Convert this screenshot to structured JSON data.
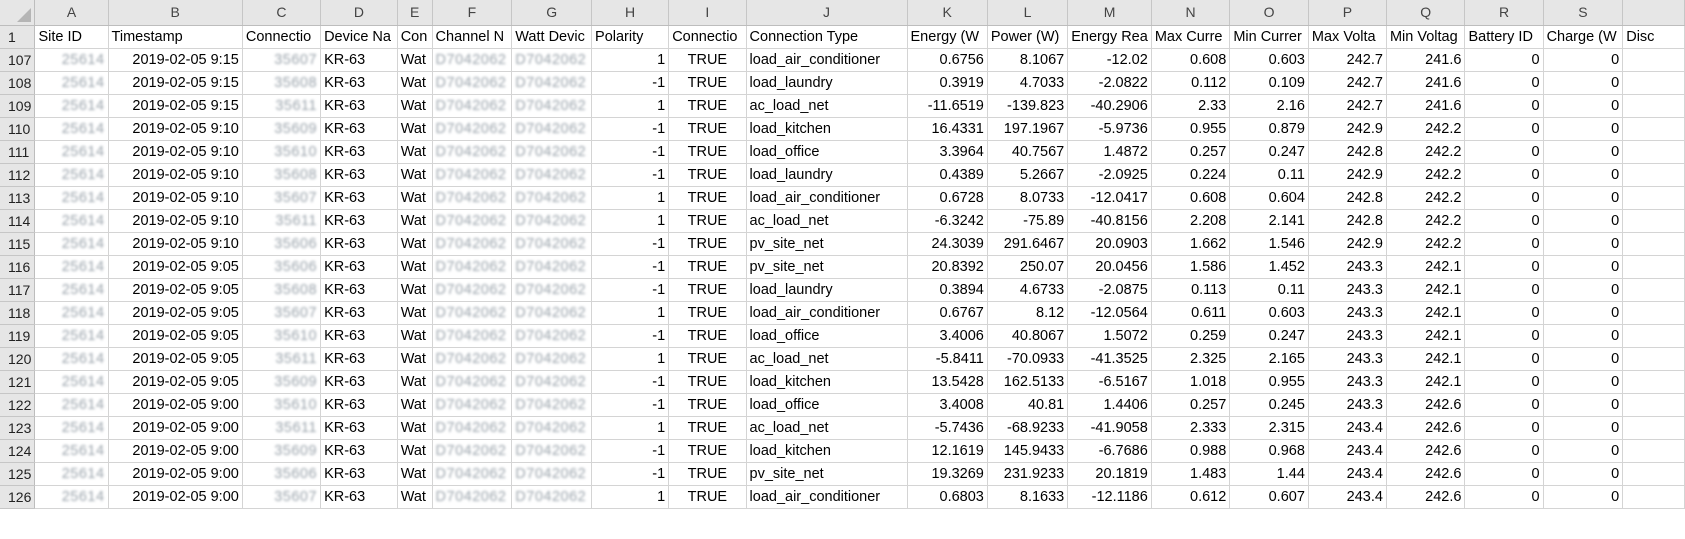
{
  "columns": [
    "A",
    "B",
    "C",
    "D",
    "E",
    "F",
    "G",
    "H",
    "I",
    "J",
    "K",
    "L",
    "M",
    "N",
    "O",
    "P",
    "Q",
    "R",
    "S",
    ""
  ],
  "header_row": {
    "row": "1",
    "cells": [
      "Site ID",
      "Timestamp",
      "Connectio",
      "Device Na",
      "Con",
      "Channel N",
      "Watt Devic",
      "Polarity",
      "Connectio",
      "Connection Type",
      "Energy (W",
      "Power (W)",
      "Energy Rea",
      "Max Curre",
      "Min Currer",
      "Max Volta",
      "Min Voltag",
      "Battery ID",
      "Charge (W",
      "Disc"
    ]
  },
  "rows": [
    {
      "row": "107",
      "site_id": "25614",
      "timestamp": "2019-02-05 9:15",
      "connection": "35607",
      "device": "KR-63",
      "con": "Wat",
      "channel": "D7042062",
      "watt_device": "D7042062",
      "polarity": "1",
      "connected": "TRUE",
      "type": "load_air_conditioner",
      "energy": "0.6756",
      "power": "8.1067",
      "energy_reactive": "-12.02",
      "max_current": "0.608",
      "min_current": "0.603",
      "max_voltage": "242.7",
      "min_voltage": "241.6",
      "battery": "0",
      "charge": "0"
    },
    {
      "row": "108",
      "site_id": "25614",
      "timestamp": "2019-02-05 9:15",
      "connection": "35608",
      "device": "KR-63",
      "con": "Wat",
      "channel": "D7042062",
      "watt_device": "D7042062",
      "polarity": "-1",
      "connected": "TRUE",
      "type": "load_laundry",
      "energy": "0.3919",
      "power": "4.7033",
      "energy_reactive": "-2.0822",
      "max_current": "0.112",
      "min_current": "0.109",
      "max_voltage": "242.7",
      "min_voltage": "241.6",
      "battery": "0",
      "charge": "0"
    },
    {
      "row": "109",
      "site_id": "25614",
      "timestamp": "2019-02-05 9:15",
      "connection": "35611",
      "device": "KR-63",
      "con": "Wat",
      "channel": "D7042062",
      "watt_device": "D7042062",
      "polarity": "1",
      "connected": "TRUE",
      "type": "ac_load_net",
      "energy": "-11.6519",
      "power": "-139.823",
      "energy_reactive": "-40.2906",
      "max_current": "2.33",
      "min_current": "2.16",
      "max_voltage": "242.7",
      "min_voltage": "241.6",
      "battery": "0",
      "charge": "0"
    },
    {
      "row": "110",
      "site_id": "25614",
      "timestamp": "2019-02-05 9:10",
      "connection": "35609",
      "device": "KR-63",
      "con": "Wat",
      "channel": "D7042062",
      "watt_device": "D7042062",
      "polarity": "-1",
      "connected": "TRUE",
      "type": "load_kitchen",
      "energy": "16.4331",
      "power": "197.1967",
      "energy_reactive": "-5.9736",
      "max_current": "0.955",
      "min_current": "0.879",
      "max_voltage": "242.9",
      "min_voltage": "242.2",
      "battery": "0",
      "charge": "0"
    },
    {
      "row": "111",
      "site_id": "25614",
      "timestamp": "2019-02-05 9:10",
      "connection": "35610",
      "device": "KR-63",
      "con": "Wat",
      "channel": "D7042062",
      "watt_device": "D7042062",
      "polarity": "-1",
      "connected": "TRUE",
      "type": "load_office",
      "energy": "3.3964",
      "power": "40.7567",
      "energy_reactive": "1.4872",
      "max_current": "0.257",
      "min_current": "0.247",
      "max_voltage": "242.8",
      "min_voltage": "242.2",
      "battery": "0",
      "charge": "0"
    },
    {
      "row": "112",
      "site_id": "25614",
      "timestamp": "2019-02-05 9:10",
      "connection": "35608",
      "device": "KR-63",
      "con": "Wat",
      "channel": "D7042062",
      "watt_device": "D7042062",
      "polarity": "-1",
      "connected": "TRUE",
      "type": "load_laundry",
      "energy": "0.4389",
      "power": "5.2667",
      "energy_reactive": "-2.0925",
      "max_current": "0.224",
      "min_current": "0.11",
      "max_voltage": "242.9",
      "min_voltage": "242.2",
      "battery": "0",
      "charge": "0"
    },
    {
      "row": "113",
      "site_id": "25614",
      "timestamp": "2019-02-05 9:10",
      "connection": "35607",
      "device": "KR-63",
      "con": "Wat",
      "channel": "D7042062",
      "watt_device": "D7042062",
      "polarity": "1",
      "connected": "TRUE",
      "type": "load_air_conditioner",
      "energy": "0.6728",
      "power": "8.0733",
      "energy_reactive": "-12.0417",
      "max_current": "0.608",
      "min_current": "0.604",
      "max_voltage": "242.8",
      "min_voltage": "242.2",
      "battery": "0",
      "charge": "0"
    },
    {
      "row": "114",
      "site_id": "25614",
      "timestamp": "2019-02-05 9:10",
      "connection": "35611",
      "device": "KR-63",
      "con": "Wat",
      "channel": "D7042062",
      "watt_device": "D7042062",
      "polarity": "1",
      "connected": "TRUE",
      "type": "ac_load_net",
      "energy": "-6.3242",
      "power": "-75.89",
      "energy_reactive": "-40.8156",
      "max_current": "2.208",
      "min_current": "2.141",
      "max_voltage": "242.8",
      "min_voltage": "242.2",
      "battery": "0",
      "charge": "0"
    },
    {
      "row": "115",
      "site_id": "25614",
      "timestamp": "2019-02-05 9:10",
      "connection": "35606",
      "device": "KR-63",
      "con": "Wat",
      "channel": "D7042062",
      "watt_device": "D7042062",
      "polarity": "-1",
      "connected": "TRUE",
      "type": "pv_site_net",
      "energy": "24.3039",
      "power": "291.6467",
      "energy_reactive": "20.0903",
      "max_current": "1.662",
      "min_current": "1.546",
      "max_voltage": "242.9",
      "min_voltage": "242.2",
      "battery": "0",
      "charge": "0"
    },
    {
      "row": "116",
      "site_id": "25614",
      "timestamp": "2019-02-05 9:05",
      "connection": "35606",
      "device": "KR-63",
      "con": "Wat",
      "channel": "D7042062",
      "watt_device": "D7042062",
      "polarity": "-1",
      "connected": "TRUE",
      "type": "pv_site_net",
      "energy": "20.8392",
      "power": "250.07",
      "energy_reactive": "20.0456",
      "max_current": "1.586",
      "min_current": "1.452",
      "max_voltage": "243.3",
      "min_voltage": "242.1",
      "battery": "0",
      "charge": "0"
    },
    {
      "row": "117",
      "site_id": "25614",
      "timestamp": "2019-02-05 9:05",
      "connection": "35608",
      "device": "KR-63",
      "con": "Wat",
      "channel": "D7042062",
      "watt_device": "D7042062",
      "polarity": "-1",
      "connected": "TRUE",
      "type": "load_laundry",
      "energy": "0.3894",
      "power": "4.6733",
      "energy_reactive": "-2.0875",
      "max_current": "0.113",
      "min_current": "0.11",
      "max_voltage": "243.3",
      "min_voltage": "242.1",
      "battery": "0",
      "charge": "0"
    },
    {
      "row": "118",
      "site_id": "25614",
      "timestamp": "2019-02-05 9:05",
      "connection": "35607",
      "device": "KR-63",
      "con": "Wat",
      "channel": "D7042062",
      "watt_device": "D7042062",
      "polarity": "1",
      "connected": "TRUE",
      "type": "load_air_conditioner",
      "energy": "0.6767",
      "power": "8.12",
      "energy_reactive": "-12.0564",
      "max_current": "0.611",
      "min_current": "0.603",
      "max_voltage": "243.3",
      "min_voltage": "242.1",
      "battery": "0",
      "charge": "0"
    },
    {
      "row": "119",
      "site_id": "25614",
      "timestamp": "2019-02-05 9:05",
      "connection": "35610",
      "device": "KR-63",
      "con": "Wat",
      "channel": "D7042062",
      "watt_device": "D7042062",
      "polarity": "-1",
      "connected": "TRUE",
      "type": "load_office",
      "energy": "3.4006",
      "power": "40.8067",
      "energy_reactive": "1.5072",
      "max_current": "0.259",
      "min_current": "0.247",
      "max_voltage": "243.3",
      "min_voltage": "242.1",
      "battery": "0",
      "charge": "0"
    },
    {
      "row": "120",
      "site_id": "25614",
      "timestamp": "2019-02-05 9:05",
      "connection": "35611",
      "device": "KR-63",
      "con": "Wat",
      "channel": "D7042062",
      "watt_device": "D7042062",
      "polarity": "1",
      "connected": "TRUE",
      "type": "ac_load_net",
      "energy": "-5.8411",
      "power": "-70.0933",
      "energy_reactive": "-41.3525",
      "max_current": "2.325",
      "min_current": "2.165",
      "max_voltage": "243.3",
      "min_voltage": "242.1",
      "battery": "0",
      "charge": "0"
    },
    {
      "row": "121",
      "site_id": "25614",
      "timestamp": "2019-02-05 9:05",
      "connection": "35609",
      "device": "KR-63",
      "con": "Wat",
      "channel": "D7042062",
      "watt_device": "D7042062",
      "polarity": "-1",
      "connected": "TRUE",
      "type": "load_kitchen",
      "energy": "13.5428",
      "power": "162.5133",
      "energy_reactive": "-6.5167",
      "max_current": "1.018",
      "min_current": "0.955",
      "max_voltage": "243.3",
      "min_voltage": "242.1",
      "battery": "0",
      "charge": "0"
    },
    {
      "row": "122",
      "site_id": "25614",
      "timestamp": "2019-02-05 9:00",
      "connection": "35610",
      "device": "KR-63",
      "con": "Wat",
      "channel": "D7042062",
      "watt_device": "D7042062",
      "polarity": "-1",
      "connected": "TRUE",
      "type": "load_office",
      "energy": "3.4008",
      "power": "40.81",
      "energy_reactive": "1.4406",
      "max_current": "0.257",
      "min_current": "0.245",
      "max_voltage": "243.3",
      "min_voltage": "242.6",
      "battery": "0",
      "charge": "0"
    },
    {
      "row": "123",
      "site_id": "25614",
      "timestamp": "2019-02-05 9:00",
      "connection": "35611",
      "device": "KR-63",
      "con": "Wat",
      "channel": "D7042062",
      "watt_device": "D7042062",
      "polarity": "1",
      "connected": "TRUE",
      "type": "ac_load_net",
      "energy": "-5.7436",
      "power": "-68.9233",
      "energy_reactive": "-41.9058",
      "max_current": "2.333",
      "min_current": "2.315",
      "max_voltage": "243.4",
      "min_voltage": "242.6",
      "battery": "0",
      "charge": "0"
    },
    {
      "row": "124",
      "site_id": "25614",
      "timestamp": "2019-02-05 9:00",
      "connection": "35609",
      "device": "KR-63",
      "con": "Wat",
      "channel": "D7042062",
      "watt_device": "D7042062",
      "polarity": "-1",
      "connected": "TRUE",
      "type": "load_kitchen",
      "energy": "12.1619",
      "power": "145.9433",
      "energy_reactive": "-6.7686",
      "max_current": "0.988",
      "min_current": "0.968",
      "max_voltage": "243.4",
      "min_voltage": "242.6",
      "battery": "0",
      "charge": "0"
    },
    {
      "row": "125",
      "site_id": "25614",
      "timestamp": "2019-02-05 9:00",
      "connection": "35606",
      "device": "KR-63",
      "con": "Wat",
      "channel": "D7042062",
      "watt_device": "D7042062",
      "polarity": "-1",
      "connected": "TRUE",
      "type": "pv_site_net",
      "energy": "19.3269",
      "power": "231.9233",
      "energy_reactive": "20.1819",
      "max_current": "1.483",
      "min_current": "1.44",
      "max_voltage": "243.4",
      "min_voltage": "242.6",
      "battery": "0",
      "charge": "0"
    },
    {
      "row": "126",
      "site_id": "25614",
      "timestamp": "2019-02-05 9:00",
      "connection": "35607",
      "device": "KR-63",
      "con": "Wat",
      "channel": "D7042062",
      "watt_device": "D7042062",
      "polarity": "1",
      "connected": "TRUE",
      "type": "load_air_conditioner",
      "energy": "0.6803",
      "power": "8.1633",
      "energy_reactive": "-12.1186",
      "max_current": "0.612",
      "min_current": "0.607",
      "max_voltage": "243.4",
      "min_voltage": "242.6",
      "battery": "0",
      "charge": "0"
    }
  ]
}
